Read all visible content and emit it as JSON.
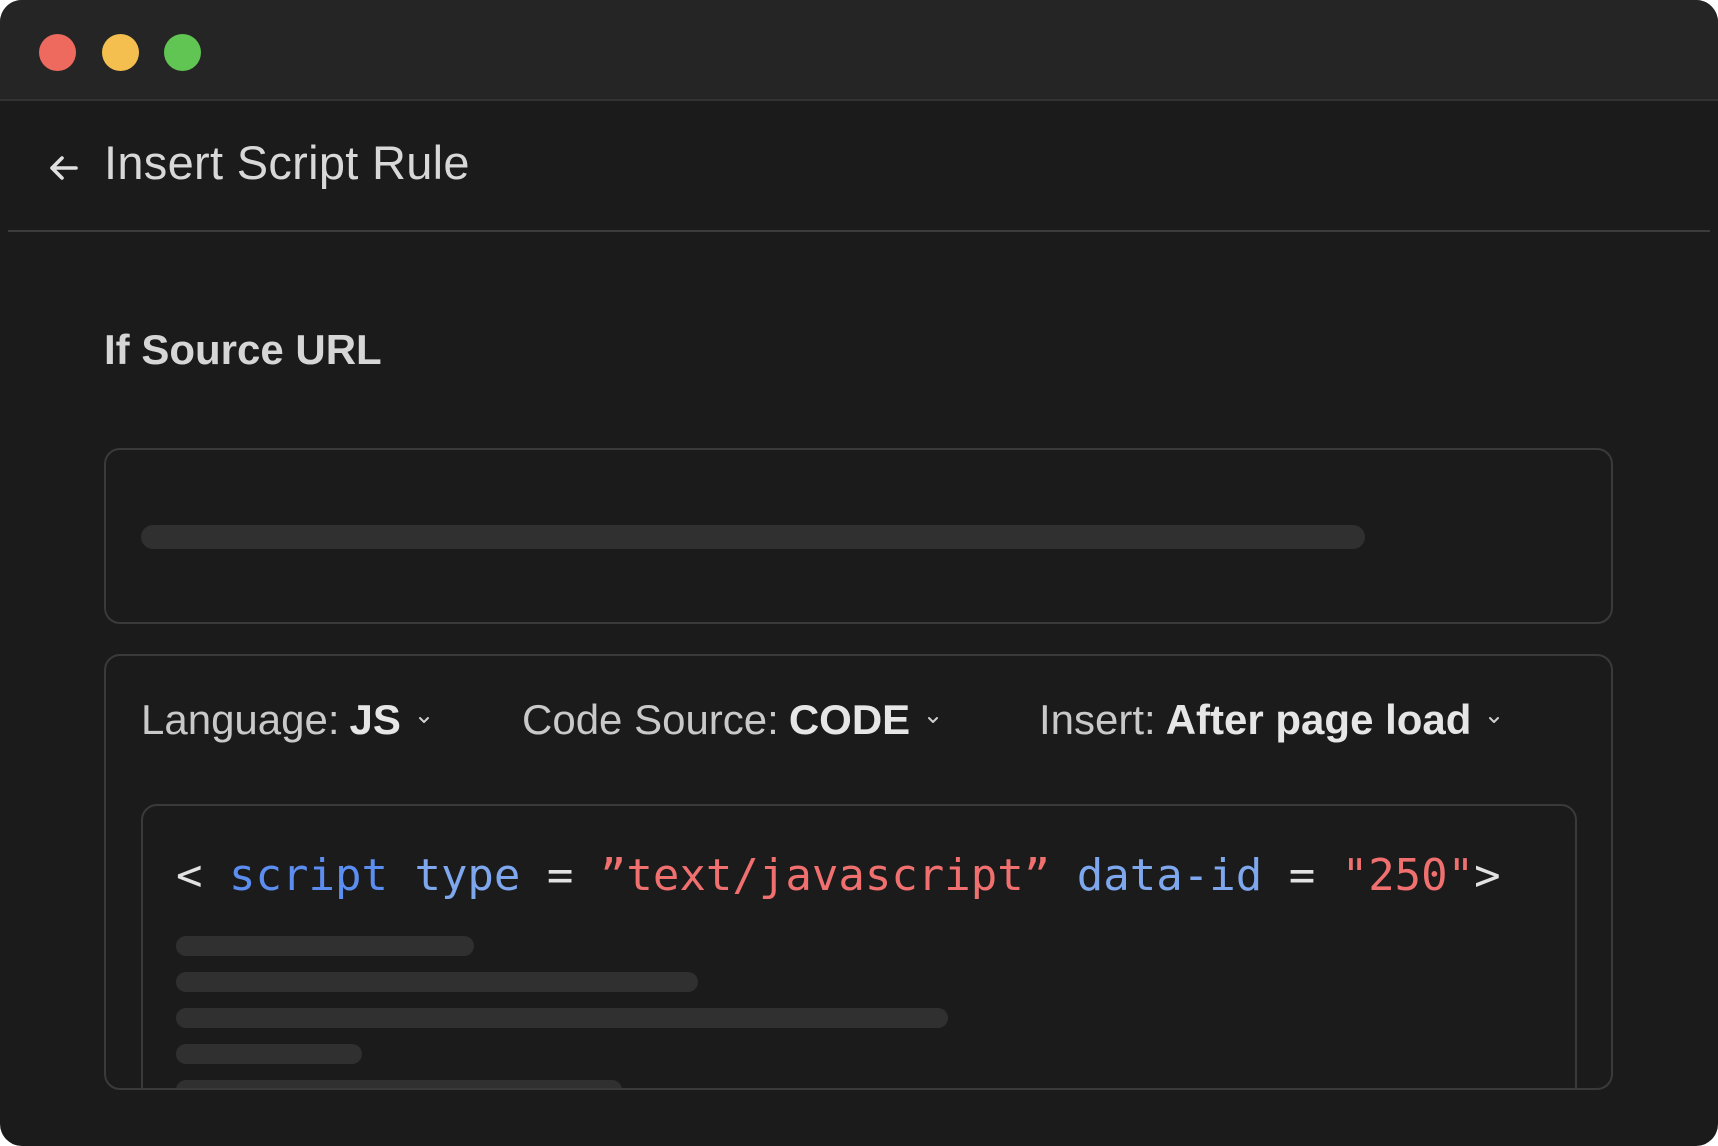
{
  "window": {
    "controls": [
      "close",
      "minimize",
      "zoom"
    ],
    "colors": {
      "close": "#ee6a5f",
      "minimize": "#f5bf4f",
      "zoom": "#61c554"
    }
  },
  "header": {
    "back_icon": "arrow-left-icon",
    "title": "Insert Script Rule"
  },
  "source_section": {
    "title": "If Source URL"
  },
  "options": {
    "language": {
      "label": "Language:",
      "value": "JS",
      "icon": "chevron-down-icon"
    },
    "code_source": {
      "label": "Code Source:",
      "value": "CODE",
      "icon": "chevron-down-icon"
    },
    "insert": {
      "label": "Insert:",
      "value": "After page load",
      "icon": "chevron-down-icon"
    }
  },
  "code": {
    "open_bracket": "<",
    "tag": "script",
    "attr1": "type",
    "eq1": "=",
    "val1": "”text/javascript”",
    "attr2": "data-id",
    "eq2": "=",
    "val2": "\"250\"",
    "close_bracket": ">"
  },
  "colors": {
    "background": "#1b1b1b",
    "titlebar": "#252525",
    "code_tag": "#5b8ef0",
    "code_attr": "#7ea7ee",
    "code_string": "#f07070"
  }
}
